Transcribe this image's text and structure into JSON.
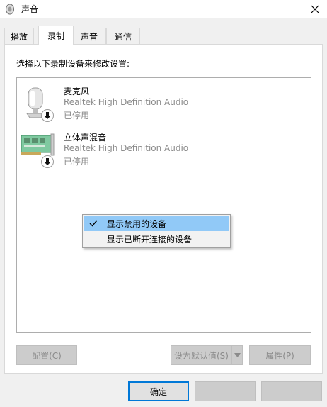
{
  "window": {
    "title": "声音",
    "close_icon": "close-icon"
  },
  "tabs": [
    {
      "label": "播放"
    },
    {
      "label": "录制",
      "active": true
    },
    {
      "label": "声音"
    },
    {
      "label": "通信"
    }
  ],
  "panel": {
    "instruction": "选择以下录制设备来修改设置:"
  },
  "devices": [
    {
      "name": "麦克风",
      "driver": "Realtek High Definition Audio",
      "status": "已停用",
      "icon": "microphone-icon",
      "badge": "down-arrow-icon"
    },
    {
      "name": "立体声混音",
      "driver": "Realtek High Definition Audio",
      "status": "已停用",
      "icon": "sound-card-icon",
      "badge": "down-arrow-icon"
    }
  ],
  "context_menu": {
    "items": [
      {
        "label": "显示禁用的设备",
        "checked": true
      },
      {
        "label": "显示已断开连接的设备",
        "checked": false
      }
    ]
  },
  "panel_buttons": {
    "configure": "配置(C)",
    "set_default": "设为默认值(S)",
    "properties": "属性(P)"
  },
  "dialog_buttons": {
    "ok": "确定",
    "cancel": "",
    "apply": ""
  },
  "colors": {
    "highlight": "#91c9f7",
    "focus_border": "#0078d7",
    "disabled_text": "#8a8a8a"
  }
}
